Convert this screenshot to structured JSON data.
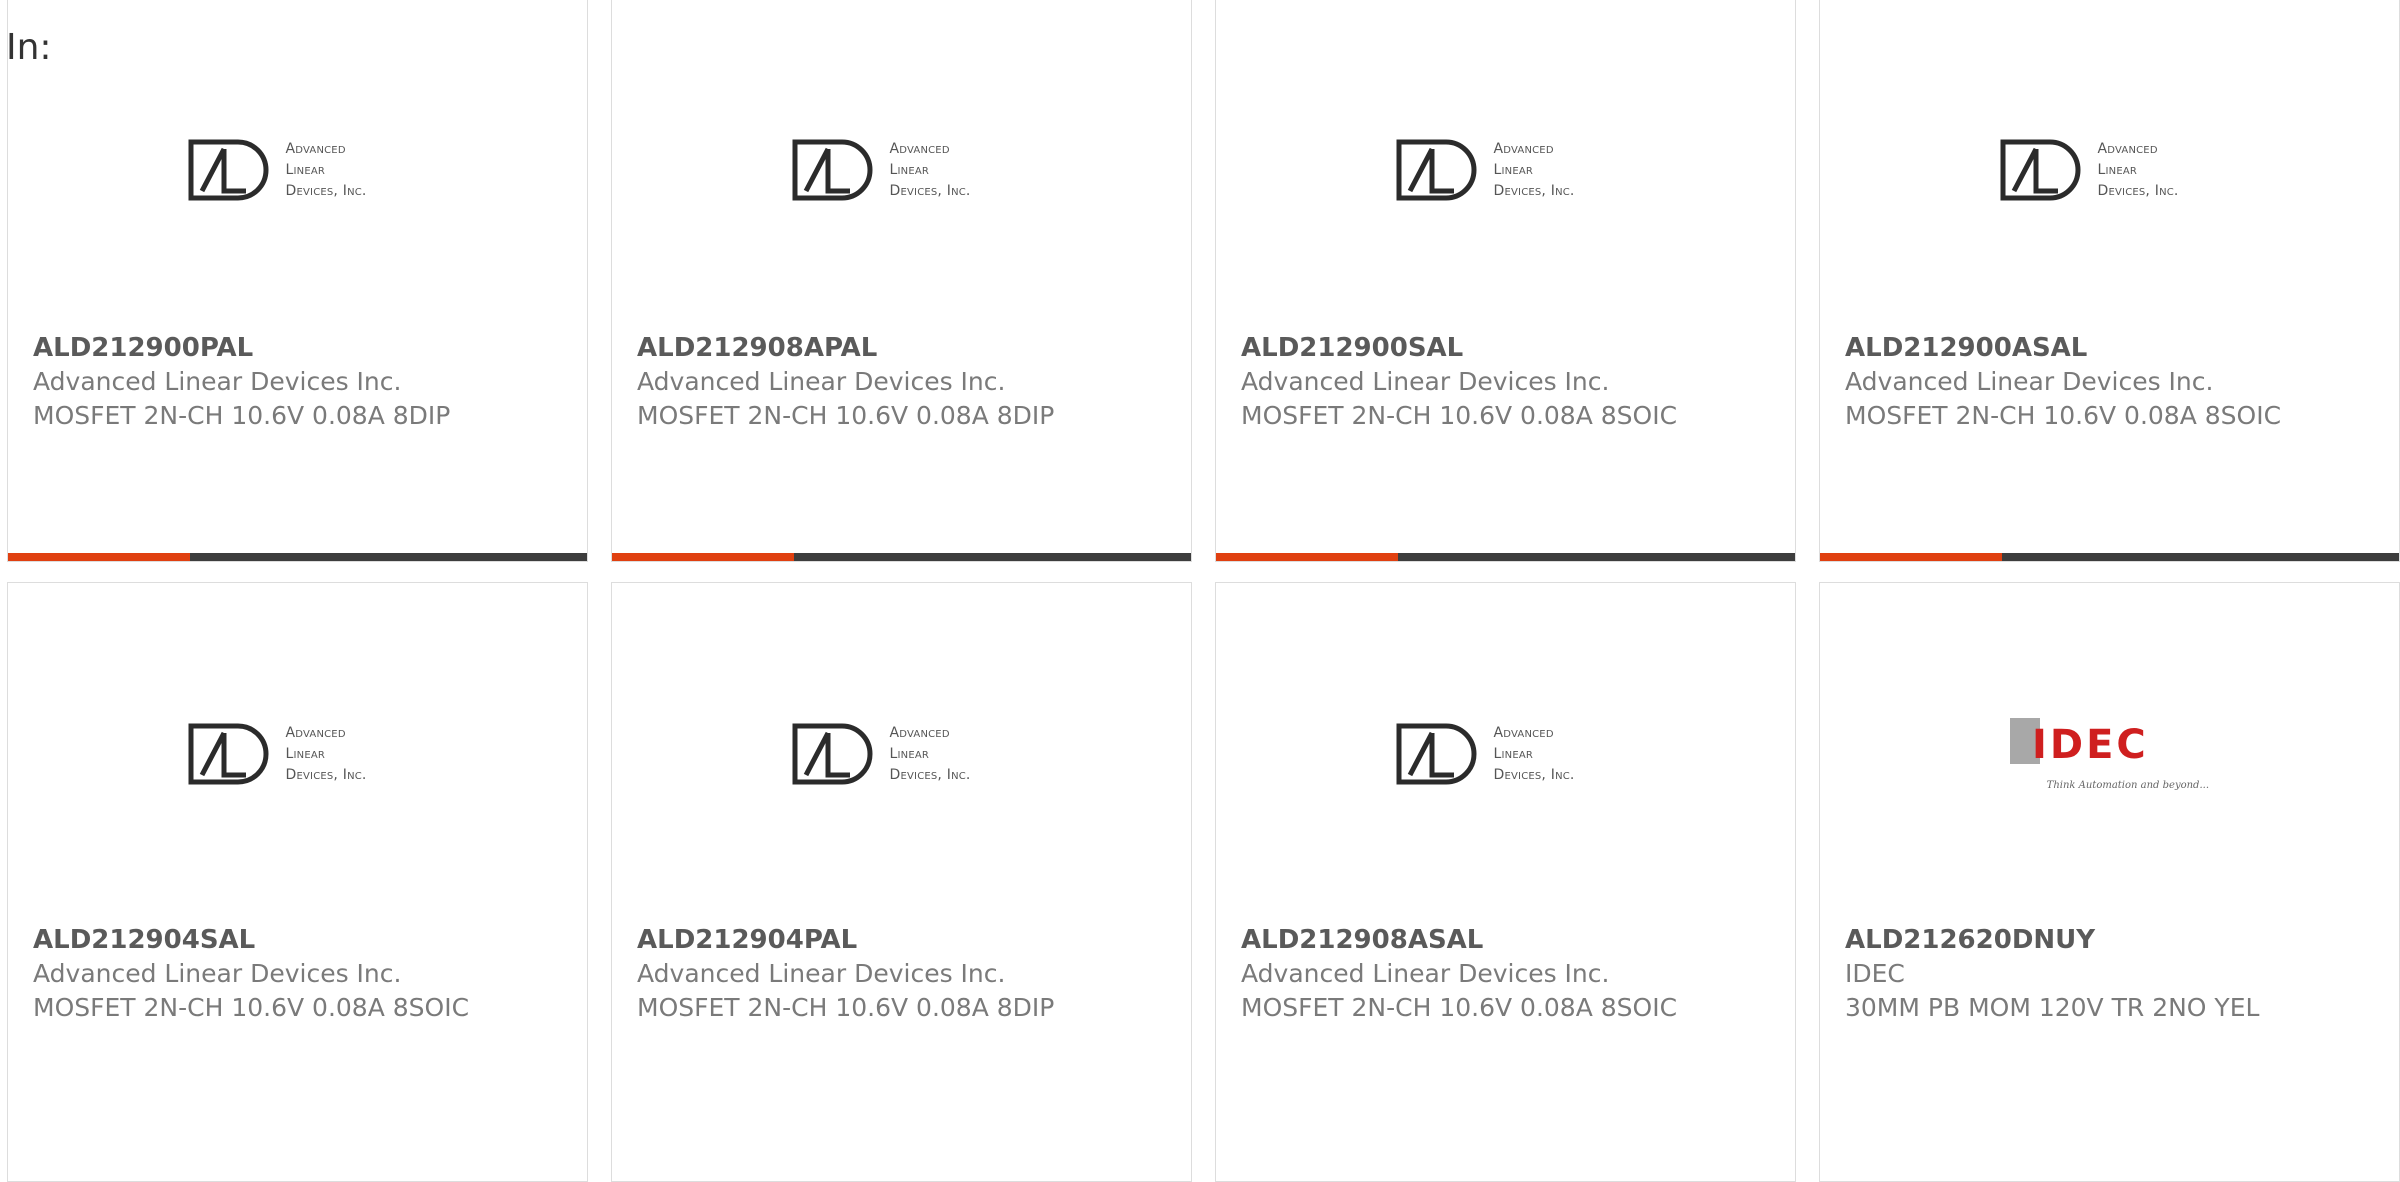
{
  "filter_label": "In:",
  "brand": {
    "accent": "#e04010",
    "bar_dark": "#3d3d3d"
  },
  "logos": {
    "ald": {
      "line1": "Advanced",
      "line2": "Linear",
      "line3": "Devices, Inc."
    },
    "idec": {
      "name": "IDEC",
      "tagline": "Think Automation and beyond..."
    }
  },
  "products": [
    {
      "part": "ALD212900PAL",
      "manufacturer": "Advanced Linear Devices Inc.",
      "description": "MOSFET 2N-CH 10.6V 0.08A 8DIP",
      "logo": "ald-logo"
    },
    {
      "part": "ALD212908APAL",
      "manufacturer": "Advanced Linear Devices Inc.",
      "description": "MOSFET 2N-CH 10.6V 0.08A 8DIP",
      "logo": "ald-logo"
    },
    {
      "part": "ALD212900SAL",
      "manufacturer": "Advanced Linear Devices Inc.",
      "description": "MOSFET 2N-CH 10.6V 0.08A 8SOIC",
      "logo": "ald-logo"
    },
    {
      "part": "ALD212900ASAL",
      "manufacturer": "Advanced Linear Devices Inc.",
      "description": "MOSFET 2N-CH 10.6V 0.08A 8SOIC",
      "logo": "ald-logo"
    },
    {
      "part": "ALD212904SAL",
      "manufacturer": "Advanced Linear Devices Inc.",
      "description": "MOSFET 2N-CH 10.6V 0.08A 8SOIC",
      "logo": "ald-logo"
    },
    {
      "part": "ALD212904PAL",
      "manufacturer": "Advanced Linear Devices Inc.",
      "description": "MOSFET 2N-CH 10.6V 0.08A 8DIP",
      "logo": "ald-logo"
    },
    {
      "part": "ALD212908ASAL",
      "manufacturer": "Advanced Linear Devices Inc.",
      "description": "MOSFET 2N-CH 10.6V 0.08A 8SOIC",
      "logo": "ald-logo"
    },
    {
      "part": "ALD212620DNUY",
      "manufacturer": "IDEC",
      "description": "30MM PB MOM 120V TR 2NO YEL",
      "logo": "idec-logo"
    }
  ]
}
